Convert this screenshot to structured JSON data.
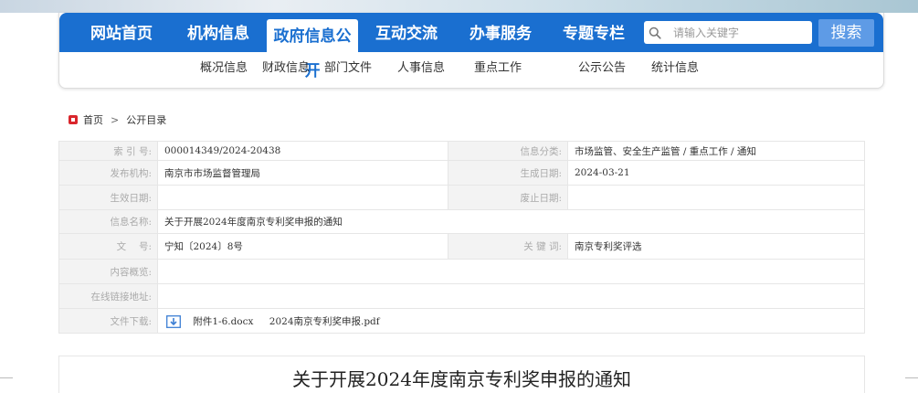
{
  "nav": {
    "items": [
      "网站首页",
      "机构信息",
      "政府信息公开",
      "互动交流",
      "办事服务",
      "专题专栏"
    ],
    "active": "政府信息公开"
  },
  "search": {
    "placeholder": "请输入关键字",
    "button_label": "搜索"
  },
  "sub_nav": {
    "items": [
      "概况信息",
      "财政信息",
      "部门文件",
      "人事信息",
      "重点工作",
      "公示公告",
      "统计信息"
    ]
  },
  "breadcrumb": {
    "home": "首页",
    "separator": ">",
    "current": "公开目录"
  },
  "info": {
    "index_label": "索 引 号:",
    "index_value": "000014349/2024-20438",
    "category_label": "信息分类:",
    "category_value": "市场监管、安全生产监管 / 重点工作 / 通知",
    "publisher_label": "发布机构:",
    "publisher_value": "南京市市场监督管理局",
    "created_label": "生成日期:",
    "created_value": "2024-03-21",
    "effective_label": "生效日期:",
    "effective_value": "",
    "expired_label": "废止日期:",
    "expired_value": "",
    "name_label": "信息名称:",
    "name_value": "关于开展2024年度南京专利奖申报的通知",
    "docno_label": "文　 号:",
    "docno_value": "宁知〔2024〕8号",
    "keyword_label": "关 键 词:",
    "keyword_value": "南京专利奖评选",
    "summary_label": "内容概览:",
    "summary_value": "",
    "link_label": "在线链接地址:",
    "link_value": "",
    "download_label": "文件下载:",
    "files": [
      "附件1-6.docx",
      "2024南京专利奖申报.pdf"
    ]
  },
  "content": {
    "title": "关于开展2024年度南京专利奖申报的通知"
  },
  "colors": {
    "nav_blue": "#1a6fd0",
    "search_button": "#5e9be6",
    "label_bg": "#f3f3f3",
    "home_icon": "#d9262c"
  },
  "icons": {
    "search": "search-icon",
    "home": "home-icon",
    "download": "download-icon"
  }
}
